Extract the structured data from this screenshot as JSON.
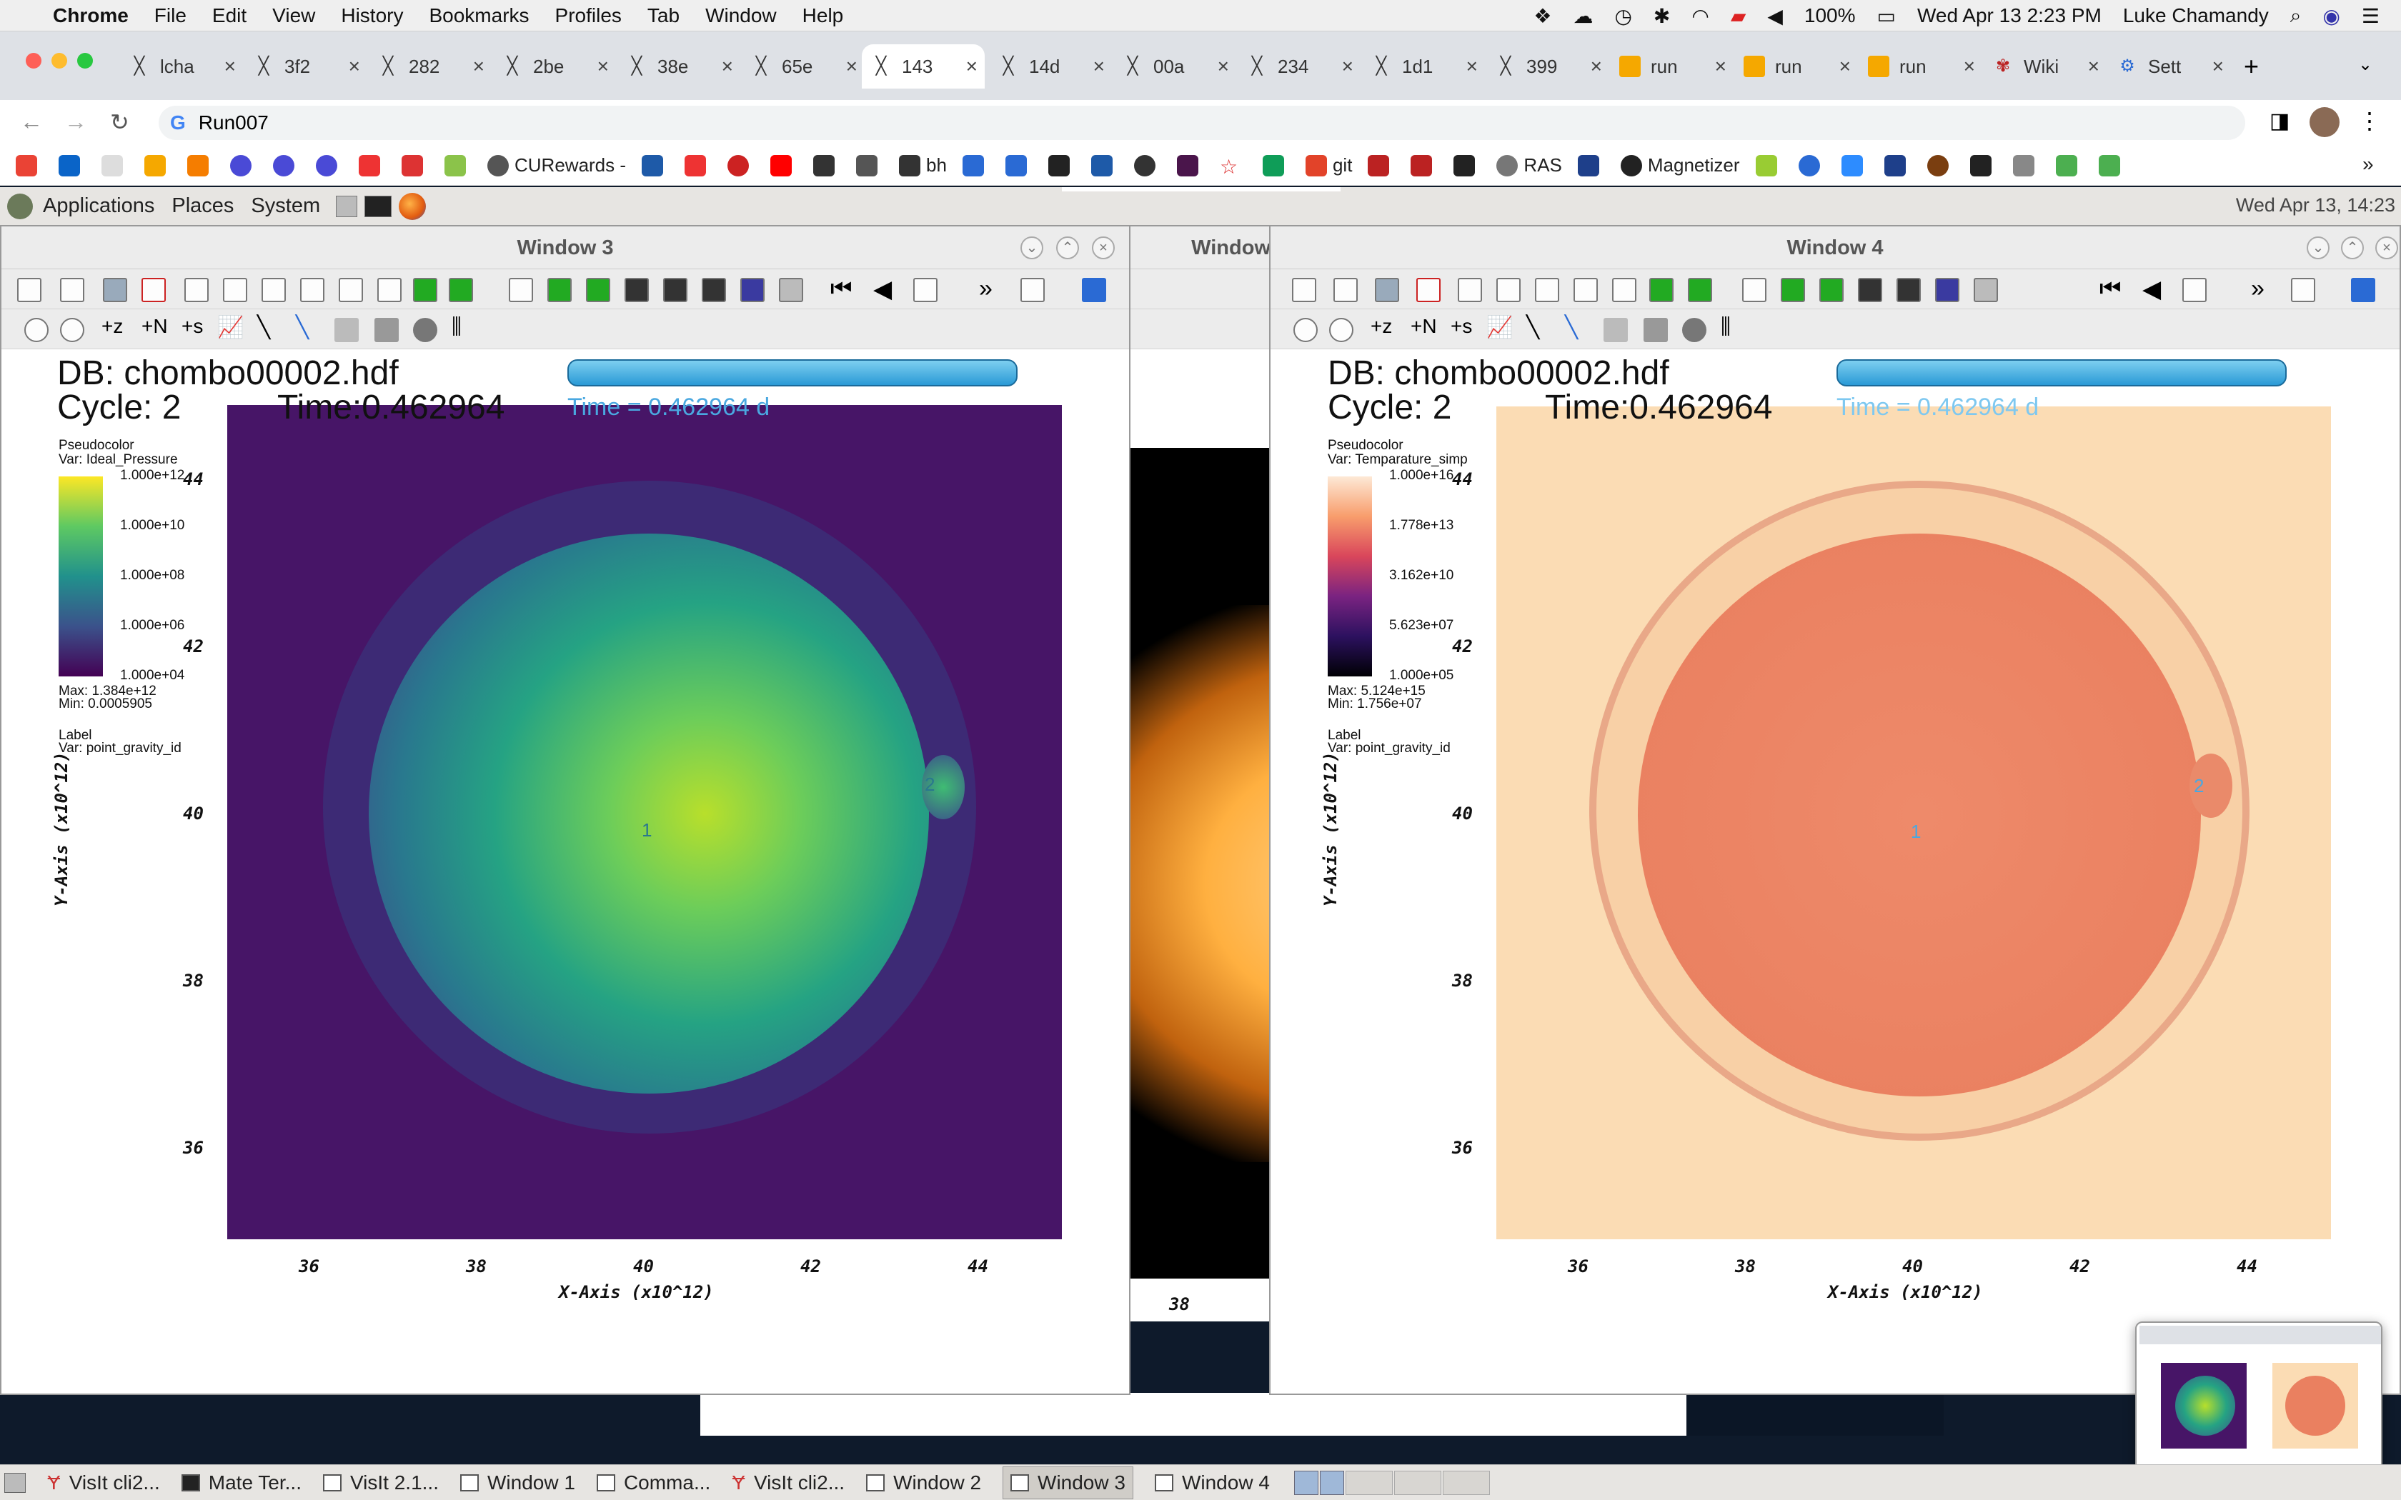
{
  "menubar": {
    "app": "Chrome",
    "items": [
      "File",
      "Edit",
      "View",
      "History",
      "Bookmarks",
      "Profiles",
      "Tab",
      "Window",
      "Help"
    ],
    "battery": "100%",
    "datetime": "Wed Apr 13  2:23 PM",
    "user": "Luke Chamandy"
  },
  "tabs": [
    "lcha",
    "3f2",
    "282",
    "2be",
    "38e",
    "65e",
    "143",
    "14d",
    "00a",
    "234",
    "1d1",
    "399",
    "run",
    "run",
    "run",
    "Wiki",
    "Sett"
  ],
  "url": "Run007",
  "bookmarks": [
    "CURewards -",
    "bh",
    "git",
    "RAS",
    "Magnetizer"
  ],
  "gnome": {
    "applications": "Applications",
    "places": "Places",
    "system": "System",
    "clock": "Wed Apr 13, 14:23"
  },
  "windows": {
    "w3": {
      "title": "Window 3",
      "db": "DB: chombo00002.hdf",
      "cycle": "Cycle: 2",
      "time": "Time:0.462964",
      "time_d": "Time = 0.462964 d",
      "plot": "Pseudocolor",
      "var": "Var: Ideal_Pressure",
      "legend": [
        "1.000e+12",
        "1.000e+10",
        "1.000e+08",
        "1.000e+06",
        "1.000e+04"
      ],
      "max": "Max:  1.384e+12",
      "min": "Min:  0.0005905",
      "label": "Label",
      "labelvar": "Var: point_gravity_id",
      "pt1": "1",
      "pt2": "2"
    },
    "w4": {
      "title": "Window 4",
      "db": "DB: chombo00002.hdf",
      "cycle": "Cycle: 2",
      "time": "Time:0.462964",
      "time_d": "Time = 0.462964 d",
      "plot": "Pseudocolor",
      "var": "Var: Temparature_simp",
      "legend": [
        "1.000e+16",
        "1.778e+13",
        "3.162e+10",
        "5.623e+07",
        "1.000e+05"
      ],
      "max": "Max:  5.124e+15",
      "min": "Min:  1.756e+07",
      "label": "Label",
      "labelvar": "Var: point_gravity_id",
      "pt1": "1",
      "pt2": "2"
    },
    "back": {
      "title": "Window",
      "tick": "38"
    }
  },
  "axes": {
    "xticks": [
      "36",
      "38",
      "40",
      "42",
      "44"
    ],
    "yticks": [
      "44",
      "42",
      "40",
      "38",
      "36"
    ],
    "xlabel": "X-Axis (x10^12)",
    "ylabel": "Y-Axis (x10^12)"
  },
  "taskbar": [
    "VisIt cli2...",
    "Mate Ter...",
    "VisIt 2.1...",
    "Window 1",
    "Comma...",
    "VisIt cli2...",
    "Window 2",
    "Window 3",
    "Window 4"
  ]
}
